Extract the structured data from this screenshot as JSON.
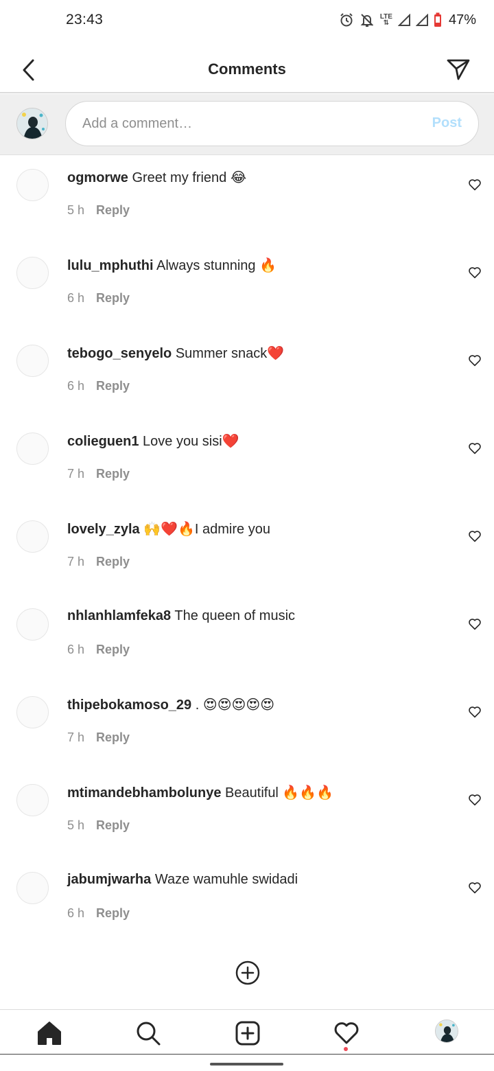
{
  "status_bar": {
    "time": "23:43",
    "network": "LTE",
    "battery_percent": "47%",
    "icons": [
      "alarm-icon",
      "bell-muted-icon",
      "lte-icon",
      "signal-icon",
      "signal-icon",
      "battery-icon"
    ]
  },
  "header": {
    "title": "Comments",
    "back_icon": "chevron-left-icon",
    "share_icon": "send-icon"
  },
  "composer": {
    "placeholder": "Add a comment…",
    "post_label": "Post"
  },
  "comments": [
    {
      "username": "ogmorwe",
      "text": "Greet my friend 😂",
      "time": "5 h",
      "reply": "Reply"
    },
    {
      "username": "lulu_mphuthi",
      "text": "Always stunning 🔥",
      "time": "6 h",
      "reply": "Reply"
    },
    {
      "username": "tebogo_senyelo",
      "text": "Summer snack❤️",
      "time": "6 h",
      "reply": "Reply"
    },
    {
      "username": "colieguen1",
      "text": "Love you sisi❤️",
      "time": "7 h",
      "reply": "Reply"
    },
    {
      "username": "lovely_zyla",
      "text": "🙌❤️🔥I admire you",
      "time": "7 h",
      "reply": "Reply"
    },
    {
      "username": "nhlanhlamfeka8",
      "text": "The queen of music",
      "time": "6 h",
      "reply": "Reply"
    },
    {
      "username": "thipebokamoso_29",
      "text": ". 😍😍😍😍😍",
      "time": "7 h",
      "reply": "Reply"
    },
    {
      "username": "mtimandebhambolunye",
      "text": "Beautiful 🔥🔥🔥",
      "time": "5 h",
      "reply": "Reply"
    },
    {
      "username": "jabumjwarha",
      "text": "Waze wamuhle swidadi",
      "time": "6 h",
      "reply": "Reply"
    }
  ],
  "load_more_icon": "plus-circle-icon",
  "bottom_nav": {
    "items": [
      "home-icon",
      "search-icon",
      "new-post-icon",
      "activity-heart-icon",
      "profile-avatar"
    ],
    "activity_notification": true
  },
  "colors": {
    "text": "#262626",
    "secondary": "#8e8e8e",
    "post_disabled": "#b2dffc",
    "notification": "#ed4956",
    "composer_bg": "#efefef"
  }
}
